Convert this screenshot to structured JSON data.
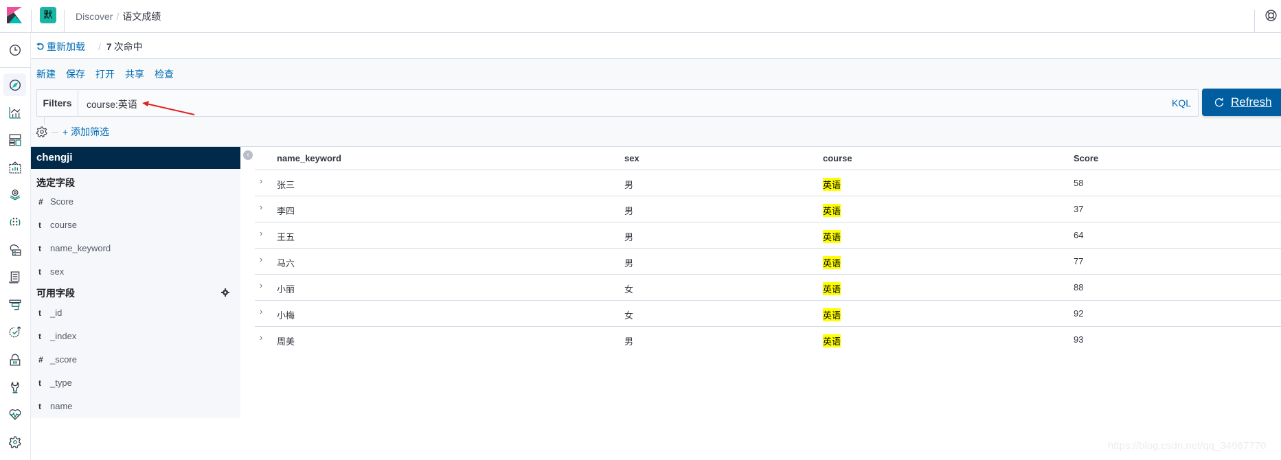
{
  "header": {
    "space_initial": "默",
    "breadcrumb": [
      "Discover",
      "语文成绩"
    ],
    "help_icon": "help-lifebuoy-icon"
  },
  "nav": {
    "icons": [
      "clock-icon",
      "discover-compass-icon",
      "visualize-icon",
      "dashboard-icon",
      "canvas-icon",
      "maps-icon",
      "ml-icon",
      "infrastructure-icon",
      "logs-icon",
      "apm-icon",
      "uptime-icon",
      "siem-icon",
      "dev-tools-icon",
      "monitoring-icon",
      "management-gear-icon"
    ]
  },
  "subheader": {
    "reload_label": "重新加载",
    "hits_count": "7",
    "hits_suffix": "次命中"
  },
  "menu": {
    "new": "新建",
    "save": "保存",
    "open": "打开",
    "share": "共享",
    "inspect": "检查"
  },
  "query": {
    "filters_label": "Filters",
    "value": "course:英语",
    "language": "KQL",
    "refresh_label": "Refresh",
    "add_filter": "+ 添加筛选"
  },
  "sidebar": {
    "index_pattern": "chengji",
    "selected_title": "选定字段",
    "selected_fields": [
      {
        "type": "#",
        "name": "Score"
      },
      {
        "type": "t",
        "name": "course"
      },
      {
        "type": "t",
        "name": "name_keyword"
      },
      {
        "type": "t",
        "name": "sex"
      }
    ],
    "available_title": "可用字段",
    "available_fields": [
      {
        "type": "t",
        "name": "_id"
      },
      {
        "type": "t",
        "name": "_index"
      },
      {
        "type": "#",
        "name": "_score"
      },
      {
        "type": "t",
        "name": "_type"
      },
      {
        "type": "t",
        "name": "name"
      }
    ]
  },
  "table": {
    "columns": [
      "name_keyword",
      "sex",
      "course",
      "Score"
    ],
    "rows": [
      {
        "name_keyword": "张三",
        "sex": "男",
        "course": "英语",
        "Score": "58"
      },
      {
        "name_keyword": "李四",
        "sex": "男",
        "course": "英语",
        "Score": "37"
      },
      {
        "name_keyword": "王五",
        "sex": "男",
        "course": "英语",
        "Score": "64"
      },
      {
        "name_keyword": "马六",
        "sex": "男",
        "course": "英语",
        "Score": "77"
      },
      {
        "name_keyword": "小丽",
        "sex": "女",
        "course": "英语",
        "Score": "88"
      },
      {
        "name_keyword": "小梅",
        "sex": "女",
        "course": "英语",
        "Score": "92"
      },
      {
        "name_keyword": "周美",
        "sex": "男",
        "course": "英语",
        "Score": "93"
      }
    ],
    "highlight_color": "#ffff00"
  },
  "watermark": "https://blog.csdn.net/qq_34967770",
  "colors": {
    "accent": "#006bb4",
    "refresh_button": "#005ea0",
    "index_header": "#00294a",
    "space_badge": "#1bb5a3"
  }
}
